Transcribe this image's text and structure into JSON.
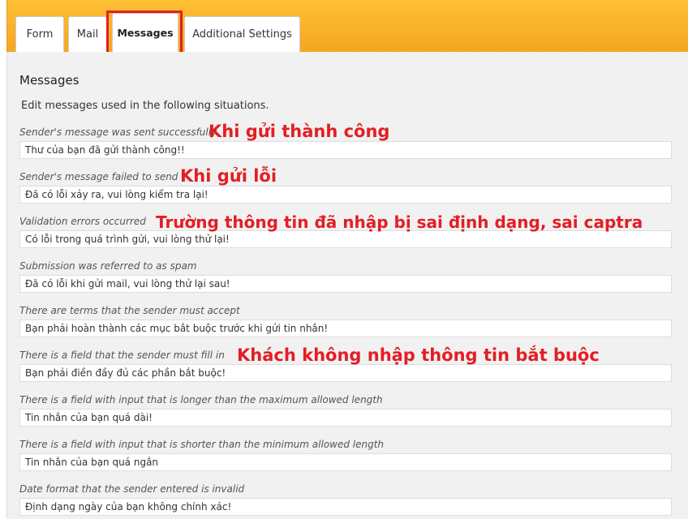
{
  "tabs": {
    "form": "Form",
    "mail": "Mail",
    "messages": "Messages",
    "additional": "Additional Settings"
  },
  "section": {
    "title": "Messages",
    "intro": "Edit messages used in the following situations."
  },
  "fields": [
    {
      "label": "Sender's message was sent successfully",
      "value": "Thư của bạn đã gửi thành công!!"
    },
    {
      "label": "Sender's message failed to send",
      "value": "Đã có lỗi xảy ra, vui lòng kiểm tra lại!"
    },
    {
      "label": "Validation errors occurred",
      "value": "Có lỗi trong quá trình gửi, vui lòng thử lại!"
    },
    {
      "label": "Submission was referred to as spam",
      "value": "Đã có lỗi khi gửi mail, vui lòng thử lại sau!"
    },
    {
      "label": "There are terms that the sender must accept",
      "value": "Bạn phải hoàn thành các mục bắt buộc trước khi gửi tin nhắn!"
    },
    {
      "label": "There is a field that the sender must fill in",
      "value": "Bạn phải điền đầy đủ các phần bắt buộc!"
    },
    {
      "label": "There is a field with input that is longer than the maximum allowed length",
      "value": "Tin nhắn của bạn quá dài!"
    },
    {
      "label": "There is a field with input that is shorter than the minimum allowed length",
      "value": "Tin nhắn của bạn quá ngắn"
    },
    {
      "label": "Date format that the sender entered is invalid",
      "value": "Định dạng ngày của bạn không chính xác!"
    }
  ],
  "annotations": {
    "success": "Khi gửi thành công",
    "failed": "Khi gửi lỗi",
    "validation": "Trường thông tin đã nhập bị sai định dạng, sai captra",
    "required": "Khách không nhập thông tin bắt buộc"
  },
  "colors": {
    "tabbar": "#f5a623",
    "annotation": "#e31e24",
    "panel": "#f1f1f1"
  }
}
